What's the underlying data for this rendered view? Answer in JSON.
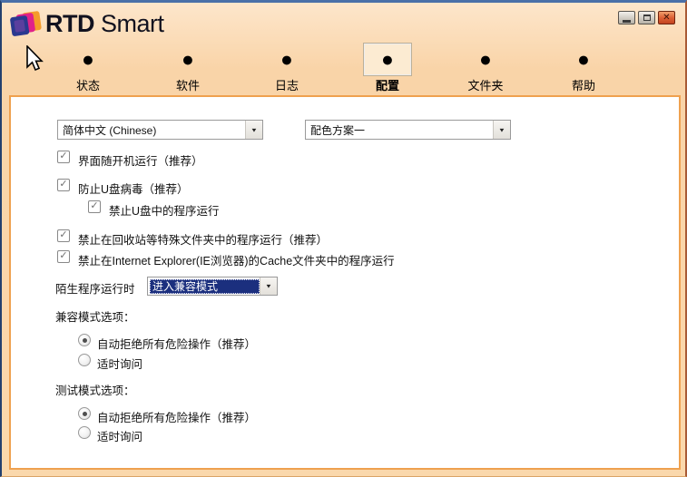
{
  "window": {
    "title_brand": "RTD",
    "title_product": "Smart"
  },
  "icons": {
    "tab_dot": "●",
    "dropdown_arrow": "▼",
    "checkmark": "✓",
    "close": "✕"
  },
  "tabs": [
    {
      "label": "状态",
      "selected": false
    },
    {
      "label": "软件",
      "selected": false
    },
    {
      "label": "日志",
      "selected": false
    },
    {
      "label": "配置",
      "selected": true
    },
    {
      "label": "文件夹",
      "selected": false
    },
    {
      "label": "帮助",
      "selected": false
    }
  ],
  "config": {
    "language_select": "简体中文 (Chinese)",
    "scheme_select": "配色方案一",
    "checkboxes": [
      {
        "label": "界面随开机运行（推荐）",
        "checked": true
      },
      {
        "label": "防止U盘病毒（推荐）",
        "checked": true
      },
      {
        "label": "禁止U盘中的程序运行",
        "checked": true,
        "indent": true
      },
      {
        "label": "禁止在回收站等特殊文件夹中的程序运行（推荐）",
        "checked": true
      },
      {
        "label": "禁止在Internet Explorer(IE浏览器)的Cache文件夹中的程序运行",
        "checked": true
      }
    ],
    "stranger_label": "陌生程序运行时",
    "stranger_select": "进入兼容模式",
    "compat_section": {
      "title": "兼容模式选项：",
      "options": [
        {
          "label": "自动拒绝所有危险操作（推荐）",
          "selected": true
        },
        {
          "label": "适时询问",
          "selected": false
        }
      ]
    },
    "test_section": {
      "title": "测试模式选项：",
      "options": [
        {
          "label": "自动拒绝所有危险操作（推荐）",
          "selected": true
        },
        {
          "label": "适时询问",
          "selected": false
        }
      ]
    }
  },
  "colors": {
    "background": "#FAD8AC",
    "panel_border": "#EFA14F",
    "selection_highlight": "#1B2F7E",
    "close_button": "#D55B30",
    "top_border": "#4A70A8"
  }
}
